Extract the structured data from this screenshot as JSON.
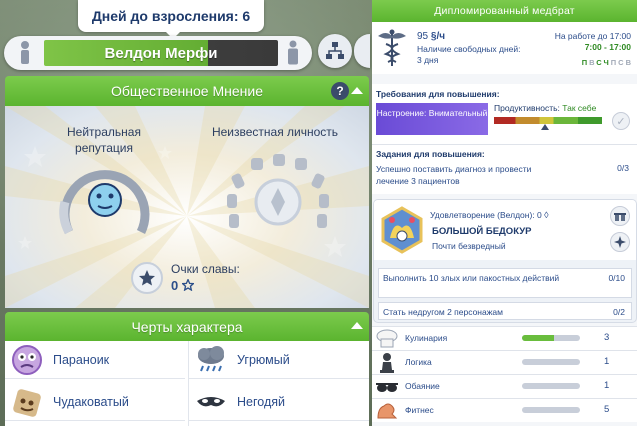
{
  "top": {
    "age_tooltip": "Дней до взросления: 6",
    "sim_name": "Велдон Мерфи"
  },
  "opinion": {
    "header": "Общественное Мнение",
    "help": "?",
    "reputation_label": "Нейтральная репутация",
    "fame_label": "Неизвестная личность",
    "glory_label": "Очки славы:",
    "glory_value": "0"
  },
  "traits": {
    "header": "Черты характера",
    "items": [
      {
        "label": "Параноик",
        "icon": "paranoid-icon"
      },
      {
        "label": "Угрюмый",
        "icon": "gloomy-icon"
      },
      {
        "label": "Чудаковатый",
        "icon": "goofy-icon"
      },
      {
        "label": "Негодяй",
        "icon": "evil-icon"
      }
    ]
  },
  "career": {
    "header": "Дипломированный медбрат",
    "salary_value": "95",
    "salary_unit": "§/ч",
    "free_days_label": "Наличие свободных дней:",
    "free_days_value": "3 дня",
    "work_label": "На работе до 17:00",
    "work_hours": "7:00 - 17:00",
    "days": [
      {
        "d": "П",
        "on": true
      },
      {
        "d": "В",
        "on": false
      },
      {
        "d": "С",
        "on": true
      },
      {
        "d": "Ч",
        "on": true
      },
      {
        "d": "П",
        "on": false
      },
      {
        "d": "С",
        "on": false
      },
      {
        "d": "В",
        "on": false
      }
    ],
    "requirements_title": "Требования для повышения:",
    "mood_text": "Настроение: Внимательный",
    "productivity_label": "Продуктивность:",
    "productivity_value": "Так себе",
    "productivity_level": 0.47,
    "tasks_title": "Задания для повышения:",
    "task_text": "Успешно поставить диагноз и провести лечение 3 пациентов",
    "task_count": "0/3"
  },
  "aspiration": {
    "satisfaction": "Удовлетворение (Велдон): 0",
    "name": "БОЛЬШОЙ БЕДОКУР",
    "desc": "Почти безвредный",
    "tasks": [
      {
        "text": "Выполнить 10 злых или пакостных действий",
        "count": "0/10"
      },
      {
        "text": "Стать недругом 2 персонажам",
        "count": "0/2"
      }
    ]
  },
  "skills": [
    {
      "name": "Кулинария",
      "level": "3",
      "progress": 0.55,
      "icon": "chef-hat-icon"
    },
    {
      "name": "Логика",
      "level": "1",
      "progress": 0.0,
      "icon": "chess-pawn-icon"
    },
    {
      "name": "Обаяние",
      "level": "1",
      "progress": 0.0,
      "icon": "sunglasses-icon"
    },
    {
      "name": "Фитнес",
      "level": "5",
      "progress": 0.0,
      "icon": "arm-muscle-icon"
    }
  ],
  "colors": {
    "header_green": "#5bb42f",
    "mood_purple": "#7559e0",
    "skill_green": "#69bd3d"
  }
}
